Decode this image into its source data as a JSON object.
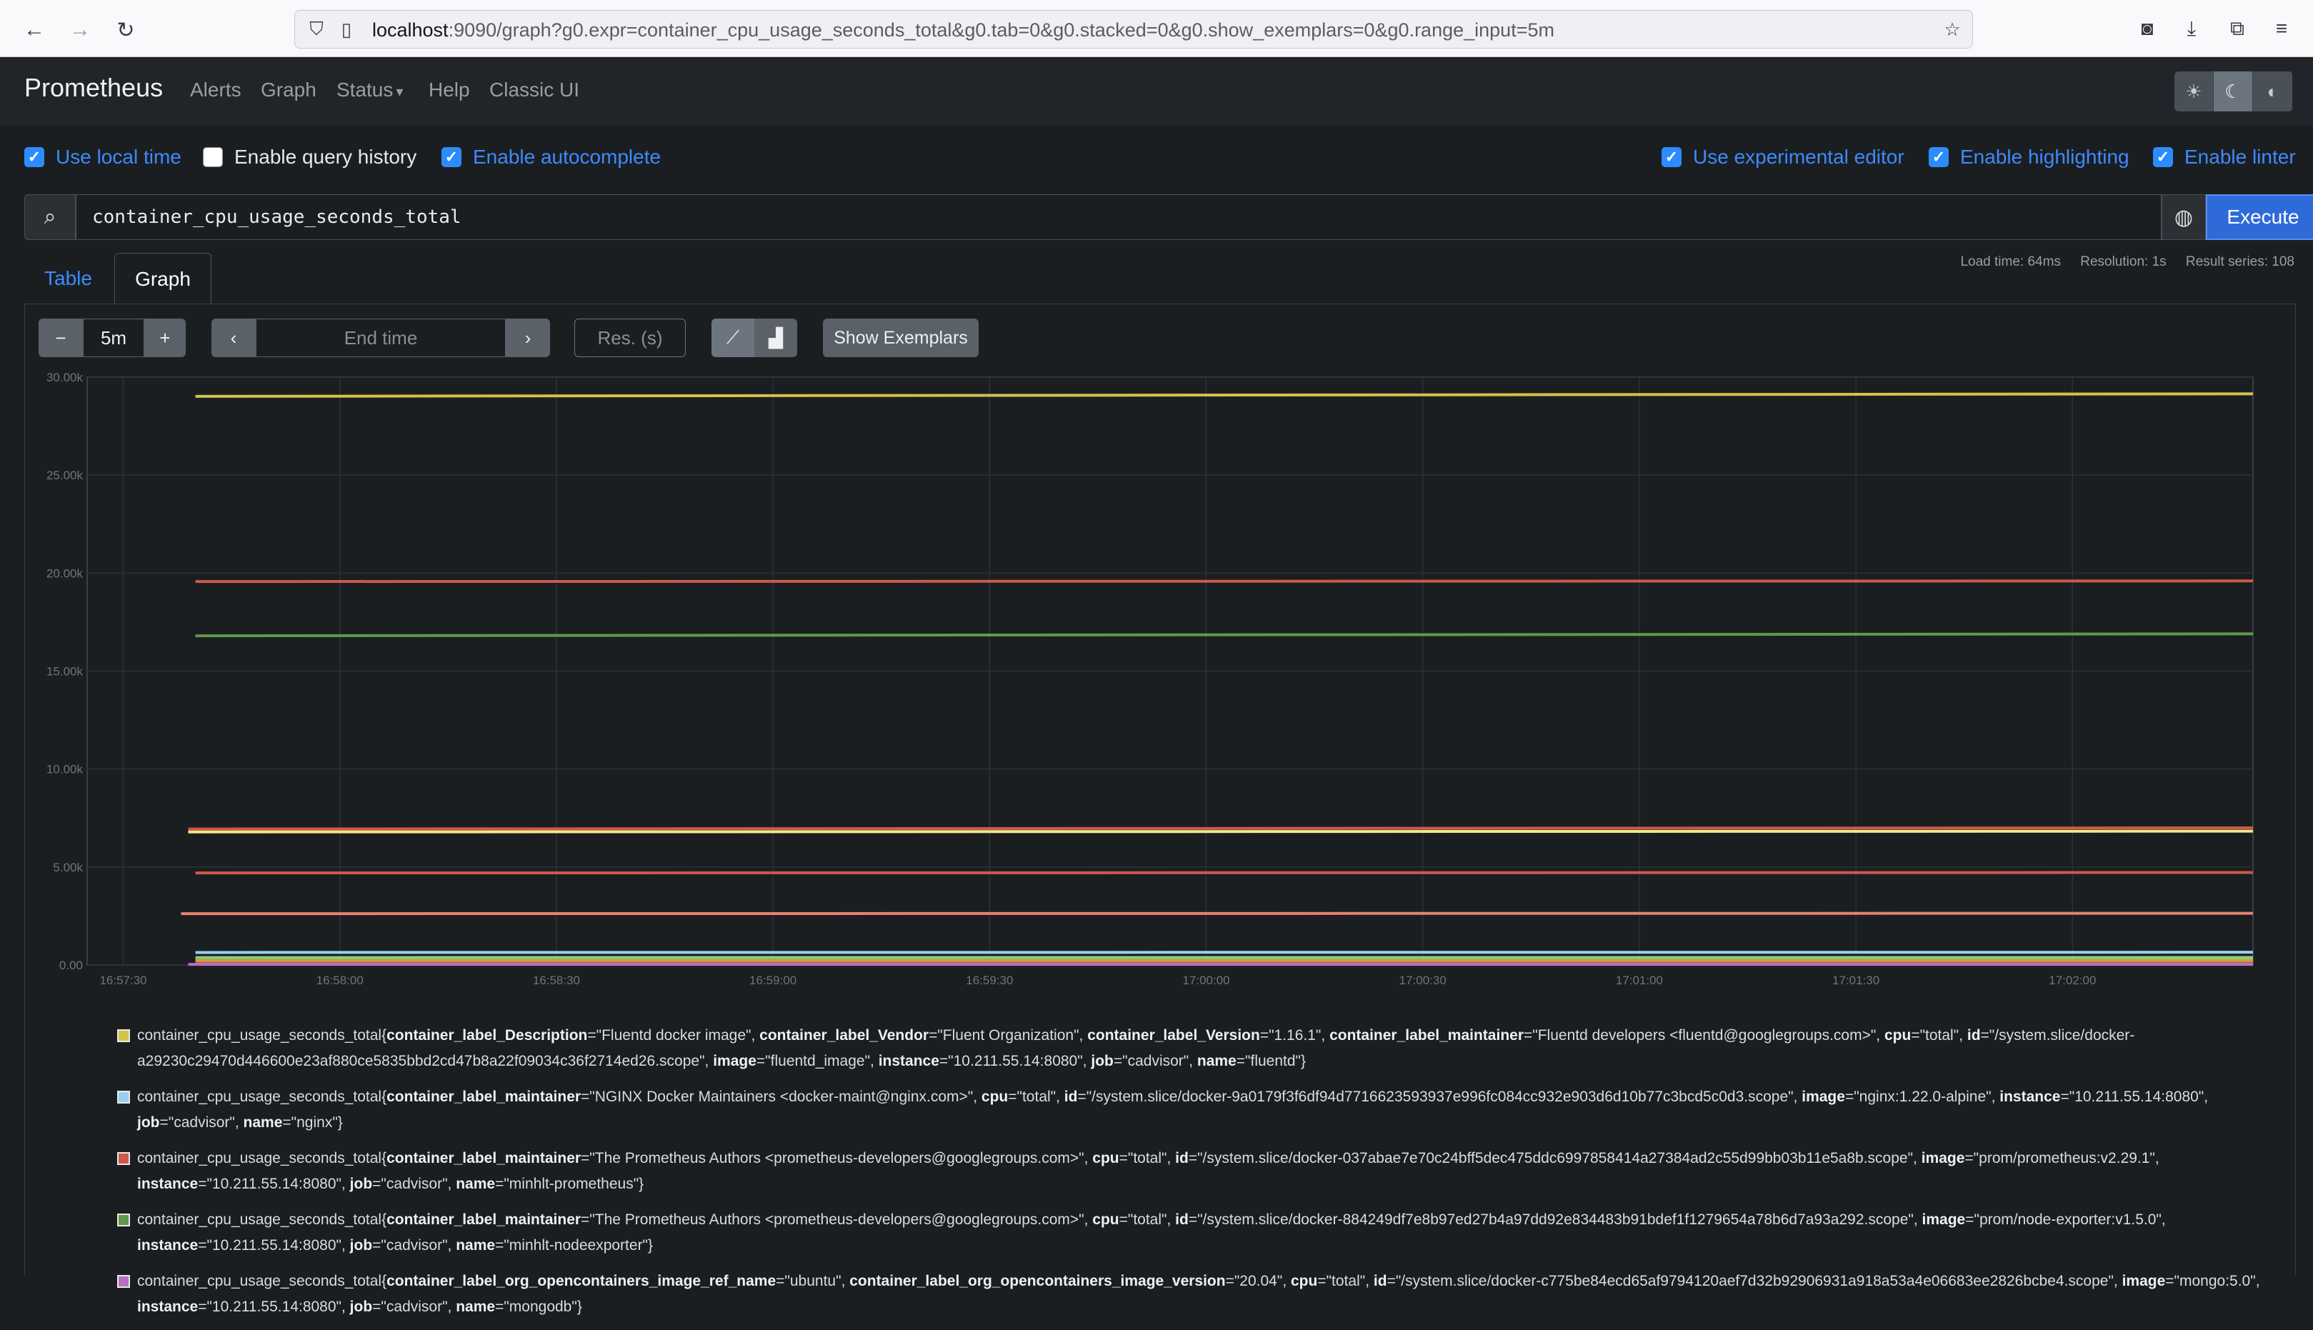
{
  "browser": {
    "url_host": "localhost",
    "url_rest": ":9090/graph?g0.expr=container_cpu_usage_seconds_total&g0.tab=0&g0.stacked=0&g0.show_exemplars=0&g0.range_input=5m"
  },
  "navbar": {
    "brand": "Prometheus",
    "links": [
      "Alerts",
      "Graph",
      "Status",
      "Help",
      "Classic UI"
    ],
    "status_caret": "▾"
  },
  "options": {
    "use_local_time": "Use local time",
    "enable_query_history": "Enable query history",
    "enable_autocomplete": "Enable autocomplete",
    "use_experimental_editor": "Use experimental editor",
    "enable_highlighting": "Enable highlighting",
    "enable_linter": "Enable linter"
  },
  "query": {
    "expression": "container_cpu_usage_seconds_total",
    "execute_label": "Execute"
  },
  "tabs": {
    "table": "Table",
    "graph": "Graph"
  },
  "stats": {
    "load_time": "Load time: 64ms",
    "resolution": "Resolution: 1s",
    "result_series": "Result series: 108"
  },
  "controls": {
    "range_value": "5m",
    "end_time_placeholder": "End time",
    "res_placeholder": "Res. (s)",
    "show_exemplars": "Show Exemplars"
  },
  "chart_data": {
    "type": "line",
    "yticks": [
      "0.00",
      "5.00k",
      "10.00k",
      "15.00k",
      "20.00k",
      "25.00k",
      "30.00k"
    ],
    "ylim": [
      0,
      30000
    ],
    "xticks": [
      "16:57:30",
      "16:58:00",
      "16:58:30",
      "16:59:00",
      "16:59:30",
      "17:00:00",
      "17:00:30",
      "17:01:00",
      "17:01:30",
      "17:02:00"
    ],
    "xlim_seconds_after_1657": [
      25,
      325
    ],
    "grid": true,
    "series": [
      {
        "color": "#d4c24a",
        "start": 40,
        "values": [
          29020,
          29150
        ]
      },
      {
        "color": "#d0584a",
        "start": 40,
        "values": [
          19570,
          19600
        ]
      },
      {
        "color": "#5f9a4a",
        "start": 40,
        "values": [
          16800,
          16900
        ]
      },
      {
        "color": "#d0584a",
        "start": 39,
        "values": [
          6940,
          7000
        ]
      },
      {
        "color": "#f2e88a",
        "start": 39,
        "values": [
          6790,
          6830
        ]
      },
      {
        "color": "#d0584a",
        "start": 40,
        "values": [
          4700,
          4720
        ]
      },
      {
        "color": "#e8826e",
        "start": 38,
        "values": [
          2620,
          2640
        ]
      },
      {
        "color": "#9ad0ee",
        "start": 40,
        "values": [
          640,
          650
        ]
      },
      {
        "color": "#8cd17d",
        "start": 40,
        "values": [
          380,
          385
        ]
      },
      {
        "color": "#c8a840",
        "start": 40,
        "values": [
          230,
          235
        ]
      },
      {
        "color": "#d0584a",
        "start": 40,
        "values": [
          90,
          92
        ]
      },
      {
        "color": "#b86fc4",
        "start": 39,
        "values": [
          30,
          32
        ]
      }
    ]
  },
  "legend": [
    {
      "color": "#d4c24a",
      "metric": "container_cpu_usage_seconds_total",
      "labels": [
        [
          "container_label_Description",
          "Fluentd docker image"
        ],
        [
          "container_label_Vendor",
          "Fluent Organization"
        ],
        [
          "container_label_Version",
          "1.16.1"
        ],
        [
          "container_label_maintainer",
          "Fluentd developers <fluentd@googlegroups.com>"
        ],
        [
          "cpu",
          "total"
        ],
        [
          "id",
          "/system.slice/docker-a29230c29470d446600e23af880ce5835bbd2cd47b8a22f09034c36f2714ed26.scope"
        ],
        [
          "image",
          "fluentd_image"
        ],
        [
          "instance",
          "10.211.55.14:8080"
        ],
        [
          "job",
          "cadvisor"
        ],
        [
          "name",
          "fluentd"
        ]
      ]
    },
    {
      "color": "#9ad0ee",
      "metric": "container_cpu_usage_seconds_total",
      "labels": [
        [
          "container_label_maintainer",
          "NGINX Docker Maintainers <docker-maint@nginx.com>"
        ],
        [
          "cpu",
          "total"
        ],
        [
          "id",
          "/system.slice/docker-9a0179f3f6df94d7716623593937e996fc084cc932e903d6d10b77c3bcd5c0d3.scope"
        ],
        [
          "image",
          "nginx:1.22.0-alpine"
        ],
        [
          "instance",
          "10.211.55.14:8080"
        ],
        [
          "job",
          "cadvisor"
        ],
        [
          "name",
          "nginx"
        ]
      ]
    },
    {
      "color": "#d0584a",
      "metric": "container_cpu_usage_seconds_total",
      "labels": [
        [
          "container_label_maintainer",
          "The Prometheus Authors <prometheus-developers@googlegroups.com>"
        ],
        [
          "cpu",
          "total"
        ],
        [
          "id",
          "/system.slice/docker-037abae7e70c24bff5dec475ddc6997858414a27384ad2c55d99bb03b11e5a8b.scope"
        ],
        [
          "image",
          "prom/prometheus:v2.29.1"
        ],
        [
          "instance",
          "10.211.55.14:8080"
        ],
        [
          "job",
          "cadvisor"
        ],
        [
          "name",
          "minhlt-prometheus"
        ]
      ]
    },
    {
      "color": "#5f9a4a",
      "metric": "container_cpu_usage_seconds_total",
      "labels": [
        [
          "container_label_maintainer",
          "The Prometheus Authors <prometheus-developers@googlegroups.com>"
        ],
        [
          "cpu",
          "total"
        ],
        [
          "id",
          "/system.slice/docker-884249df7e8b97ed27b4a97dd92e834483b91bdef1f1279654a78b6d7a93a292.scope"
        ],
        [
          "image",
          "prom/node-exporter:v1.5.0"
        ],
        [
          "instance",
          "10.211.55.14:8080"
        ],
        [
          "job",
          "cadvisor"
        ],
        [
          "name",
          "minhlt-nodeexporter"
        ]
      ]
    },
    {
      "color": "#b86fc4",
      "metric": "container_cpu_usage_seconds_total",
      "labels": [
        [
          "container_label_org_opencontainers_image_ref_name",
          "ubuntu"
        ],
        [
          "container_label_org_opencontainers_image_version",
          "20.04"
        ],
        [
          "cpu",
          "total"
        ],
        [
          "id",
          "/system.slice/docker-c775be84ecd65af9794120aef7d32b92906931a918a53a4e06683ee2826bcbe4.scope"
        ],
        [
          "image",
          "mongo:5.0"
        ],
        [
          "instance",
          "10.211.55.14:8080"
        ],
        [
          "job",
          "cadvisor"
        ],
        [
          "name",
          "mongodb"
        ]
      ]
    }
  ]
}
